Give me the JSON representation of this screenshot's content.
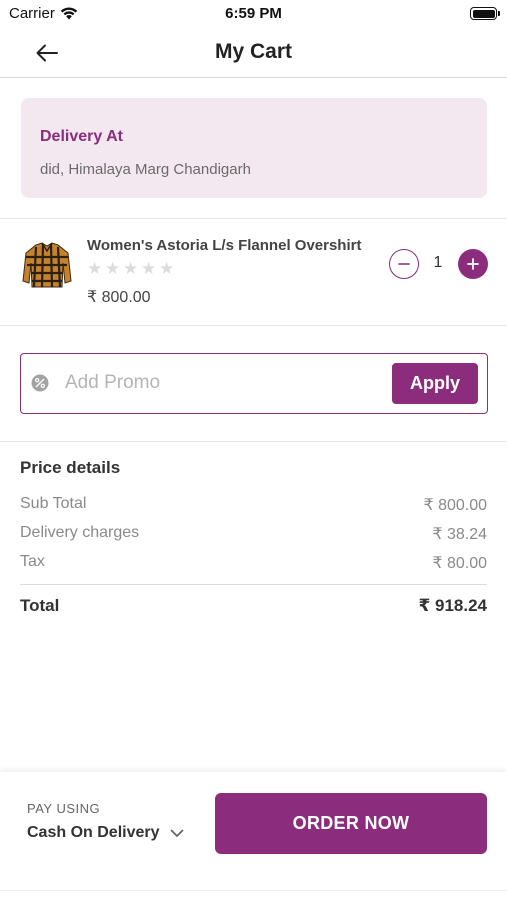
{
  "status_bar": {
    "carrier": "Carrier",
    "time": "6:59 PM"
  },
  "nav": {
    "title": "My Cart"
  },
  "delivery": {
    "title": "Delivery At",
    "address": "did, Himalaya Marg Chandigarh"
  },
  "cart_item": {
    "name": "Women's Astoria L/s Flannel Overshirt",
    "rating": 0,
    "rating_max": 5,
    "price": "₹ 800.00",
    "quantity": "1"
  },
  "promo": {
    "placeholder": "Add Promo",
    "apply_label": "Apply"
  },
  "price_details": {
    "heading": "Price details",
    "rows": [
      {
        "label": "Sub Total",
        "value": "₹ 800.00"
      },
      {
        "label": "Delivery charges",
        "value": "₹ 38.24"
      },
      {
        "label": "Tax",
        "value": "₹ 80.00"
      }
    ],
    "total": {
      "label": "Total",
      "value": "₹ 918.24"
    }
  },
  "footer": {
    "pay_label": "PAY USING",
    "pay_method": "Cash On Delivery",
    "order_label": "ORDER NOW"
  },
  "colors": {
    "accent": "#8c2c7c",
    "delivery_bg": "#f3e8ef"
  },
  "icons": [
    "wifi-icon",
    "battery-icon",
    "back-arrow-icon",
    "product-image",
    "star-icon",
    "minus-icon",
    "plus-icon",
    "promo-percent-icon",
    "chevron-down-icon"
  ]
}
